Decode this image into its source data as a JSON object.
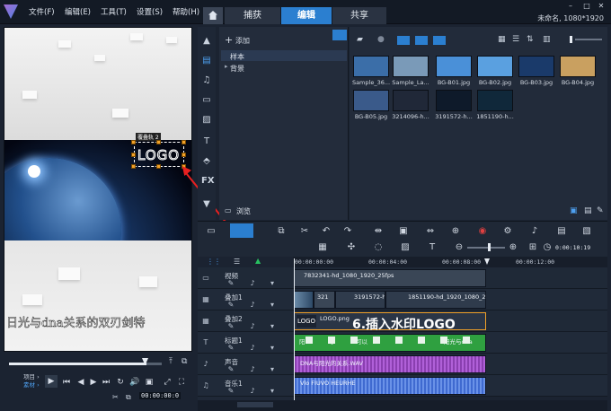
{
  "menubar": {
    "items": [
      "文件(F)",
      "编辑(E)",
      "工具(T)",
      "设置(S)",
      "帮助(H)"
    ]
  },
  "tabs": {
    "capture": "捕获",
    "edit": "编辑",
    "share": "共享",
    "active": "edit"
  },
  "project_title": "未命名, 1080*1920",
  "preview": {
    "watermark_text": "LOGO",
    "watermark_tag": "覆叠轨 2",
    "subtitle": "日光与dna关系的双刃剑特",
    "mode_labels": [
      "项目 ›",
      "素材 ›"
    ],
    "timecode": "00:00:00:0",
    "progress": 0.9
  },
  "library": {
    "add_label": "添加",
    "folders": [
      "样本",
      "背景"
    ],
    "browse_label": "浏览",
    "thumbnails": [
      {
        "label": "Sample_36...",
        "color": "#3b6ea8"
      },
      {
        "label": "Sample_La...",
        "color": "#7a9ab8"
      },
      {
        "label": "BG-B01.jpg",
        "color": "#4a90d8"
      },
      {
        "label": "BG-B02.jpg",
        "color": "#5aa0e0"
      },
      {
        "label": "BG-B03.jpg",
        "color": "#1a3a6a"
      },
      {
        "label": "BG-B04.jpg",
        "color": "#c9a060"
      },
      {
        "label": "BG-B05.jpg",
        "color": "#3a5a8a"
      },
      {
        "label": "3214096-h...",
        "color": "#202838"
      },
      {
        "label": "3191572-h...",
        "color": "#0e1a2a"
      },
      {
        "label": "1851190-h...",
        "color": "#10283a"
      }
    ]
  },
  "timeline": {
    "ruler_labels": [
      "00:00:00:00",
      "00:00:04:00",
      "00:00:08:00",
      "00:00:12:00"
    ],
    "zoom_time": "0:00:10:19",
    "tracks": [
      {
        "name": "视频"
      },
      {
        "name": "叠加1"
      },
      {
        "name": "叠加2"
      },
      {
        "name": "标题1"
      },
      {
        "name": "声音"
      },
      {
        "name": "音乐1"
      }
    ],
    "clips": {
      "video": "7832341-hd_1080_1920_25fps",
      "overlay1_a": "321",
      "overlay1_b": "3191572-hd_10",
      "overlay1_c": "1851190-hd_1920_1080_2",
      "overlay2": "LOGO.png",
      "title_items": [
        "阳",
        "可",
        "可以",
        "阳光与dna"
      ],
      "voice": "DNA与阳光的关系.WAV",
      "music": "Vlo FIUVO HEURHE"
    }
  },
  "annotation": {
    "callout": "6.插入水印LOGO",
    "color": "#e82020"
  }
}
